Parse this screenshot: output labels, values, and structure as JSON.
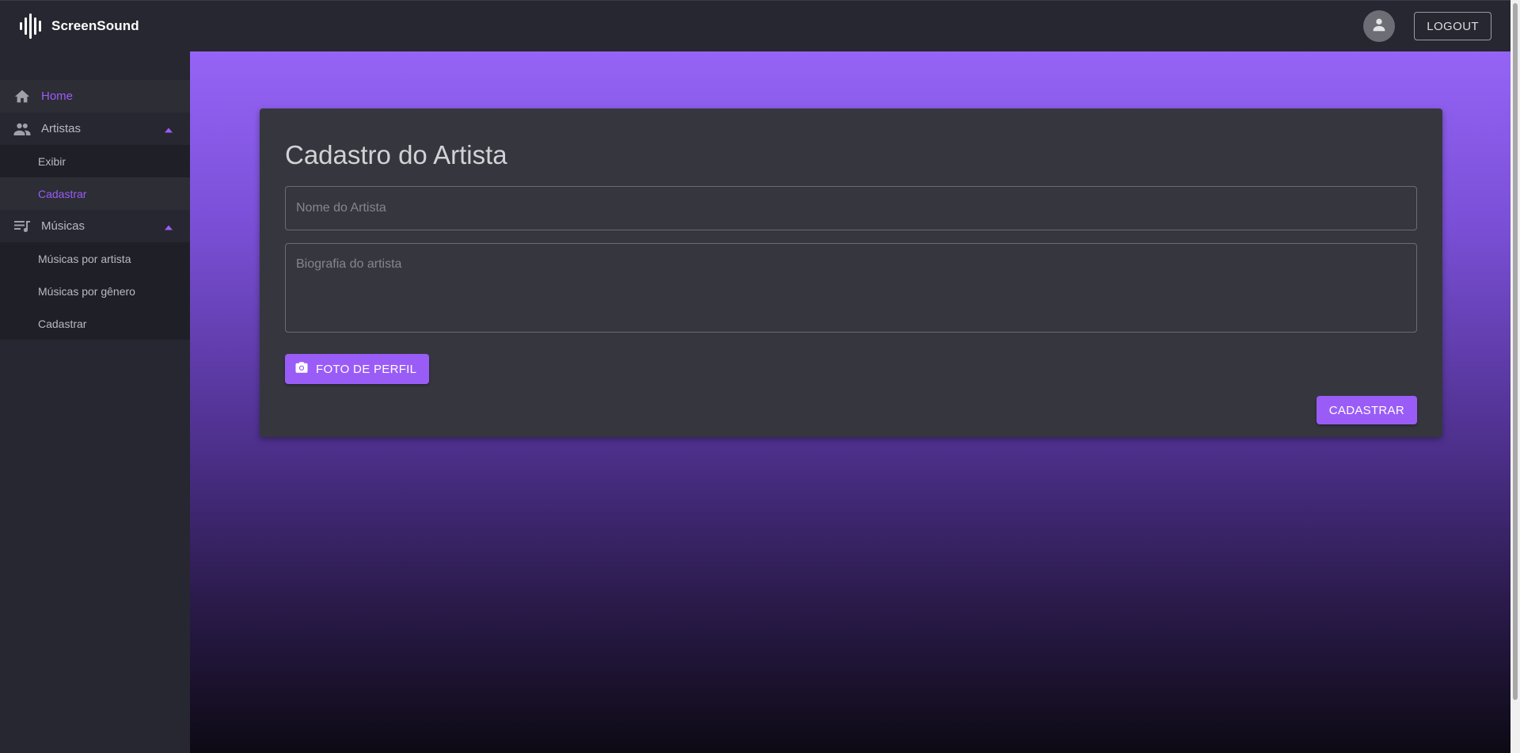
{
  "app": {
    "brand": "ScreenSound",
    "logo_icon": "sound-wave-icon"
  },
  "header": {
    "avatar_icon": "person-icon",
    "logout_label": "LOGOUT"
  },
  "sidebar": {
    "home": {
      "label": "Home",
      "icon": "home-icon"
    },
    "artists": {
      "label": "Artistas",
      "icon": "people-icon",
      "expanded": true,
      "items": [
        {
          "label": "Exibir"
        },
        {
          "label": "Cadastrar"
        }
      ]
    },
    "music": {
      "label": "Músicas",
      "icon": "queue-music-icon",
      "expanded": true,
      "items": [
        {
          "label": "Músicas por artista"
        },
        {
          "label": "Músicas por gênero"
        },
        {
          "label": "Cadastrar"
        }
      ]
    }
  },
  "form": {
    "title": "Cadastro do Artista",
    "name_placeholder": "Nome do Artista",
    "name_value": "",
    "bio_placeholder": "Biografia do artista",
    "bio_value": "",
    "photo_button_label": "FOTO DE PERFIL",
    "photo_button_icon": "camera-icon",
    "submit_label": "CADASTRAR"
  },
  "colors": {
    "accent": "#9a5cf7",
    "topbar": "#262730",
    "card": "#36373e"
  }
}
